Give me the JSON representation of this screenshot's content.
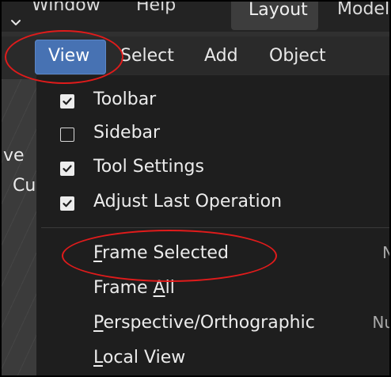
{
  "menubar": {
    "items": [
      "Window",
      "Help"
    ],
    "workspace_tabs": [
      "Layout",
      "Model"
    ]
  },
  "header": {
    "menus": [
      "View",
      "Select",
      "Add",
      "Object"
    ]
  },
  "viewport": {
    "partial_texts": [
      "ve",
      "Cu"
    ]
  },
  "view_menu": {
    "toggles": [
      {
        "label": "Toolbar",
        "checked": true
      },
      {
        "label": "Sidebar",
        "checked": false
      },
      {
        "label": "Tool Settings",
        "checked": true
      },
      {
        "label": "Adjust Last Operation",
        "checked": true
      }
    ],
    "actions": [
      {
        "label": "Frame Selected",
        "mnemonic": "F",
        "rest": "rame Selected",
        "shortcut": "N"
      },
      {
        "label": "Frame All",
        "mnemonic": "A",
        "pre": "Frame ",
        "post": "ll"
      },
      {
        "label": "Perspective/Orthographic",
        "mnemonic": "P",
        "rest": "erspective/Orthographic",
        "shortcut": "Nu"
      },
      {
        "label": "Local View",
        "mnemonic": "L",
        "rest": "ocal View"
      }
    ]
  },
  "colors": {
    "accent": "#4772b3",
    "annotation": "#e01b1b",
    "menu_bg": "#1e1e1e"
  },
  "icons": [
    "chevron-down-icon",
    "checkbox-checked-icon",
    "checkbox-unchecked-icon"
  ]
}
